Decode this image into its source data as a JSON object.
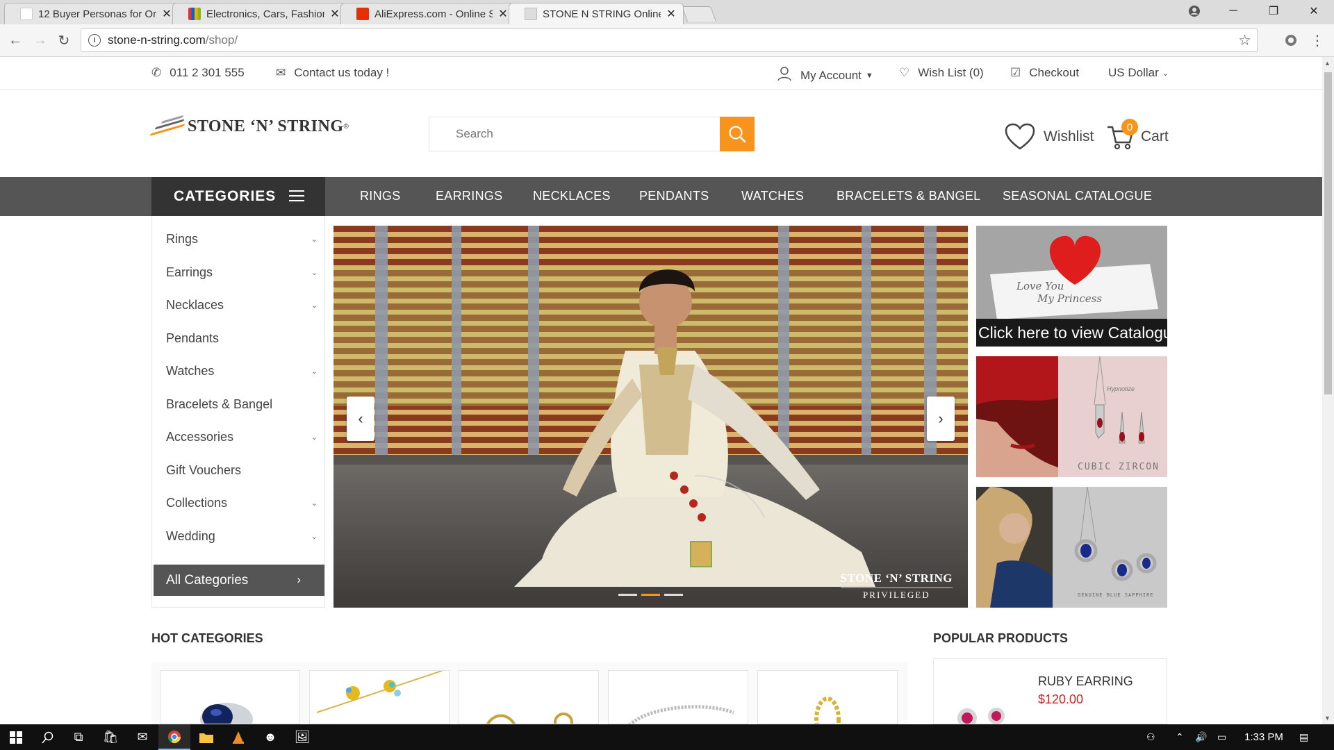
{
  "browser": {
    "tabs": [
      {
        "label": "12 Buyer Personas for Or",
        "icon": "persona-favicon",
        "active": false
      },
      {
        "label": "Electronics, Cars, Fashion",
        "icon": "ebay-favicon",
        "active": false
      },
      {
        "label": "AliExpress.com - Online S",
        "icon": "aliexpress-favicon",
        "active": false
      },
      {
        "label": "STONE N STRING Online",
        "icon": "page-favicon",
        "active": true
      }
    ],
    "url_host": "stone-n-string.com",
    "url_path": "/shop/"
  },
  "topbar": {
    "phone": "011 2 301 555",
    "contact": "Contact us today !",
    "my_account": "My Account",
    "wish_list": "Wish List (0)",
    "checkout": "Checkout",
    "currency": "US Dollar"
  },
  "header": {
    "logo_text": "STONE ‘N’ STRING",
    "logo_reg": "®",
    "search_placeholder": "Search",
    "wishlist_label": "Wishlist",
    "cart_label": "Cart",
    "cart_count": "0"
  },
  "nav": {
    "categories_label": "CATEGORIES",
    "items": [
      "RINGS",
      "EARRINGS",
      "NECKLACES",
      "PENDANTS",
      "WATCHES",
      "BRACELETS & BANGEL",
      "SEASONAL CATALOGUE"
    ]
  },
  "sidebar": {
    "items": [
      {
        "label": "Rings",
        "has_children": true
      },
      {
        "label": "Earrings",
        "has_children": true
      },
      {
        "label": "Necklaces",
        "has_children": true
      },
      {
        "label": "Pendants",
        "has_children": false
      },
      {
        "label": "Watches",
        "has_children": true
      },
      {
        "label": "Bracelets & Bangel",
        "has_children": false
      },
      {
        "label": "Accessories",
        "has_children": true
      },
      {
        "label": "Gift Vouchers",
        "has_children": false
      },
      {
        "label": "Collections",
        "has_children": true
      },
      {
        "label": "Wedding",
        "has_children": true
      }
    ],
    "all_categories": "All Categories"
  },
  "slider": {
    "logo_line1": "STONE ‘N’ STRING",
    "logo_line2": "PRIVILEGED",
    "active_slide": 2,
    "slide_count": 3
  },
  "banners": {
    "catalogue_script_1": "Love You",
    "catalogue_script_2": "My Princess",
    "catalogue_caption": "Click here to view Catalogue",
    "zircon_text": "CUBIC ZIRCON",
    "zircon_brand": "Hypnotize",
    "sapphire_text": "GENUINE BLUE SAPPHIRE"
  },
  "sections": {
    "hot_categories": "HOT CATEGORIES",
    "popular_products": "POPULAR PRODUCTS"
  },
  "popular": [
    {
      "name": "RUBY EARRING",
      "price": "$120.00"
    }
  ],
  "taskbar": {
    "time": "1:33 PM"
  },
  "colors": {
    "accent": "#f7941d",
    "nav_bg": "#555555",
    "categories_bg": "#333333",
    "price": "#c62828"
  }
}
